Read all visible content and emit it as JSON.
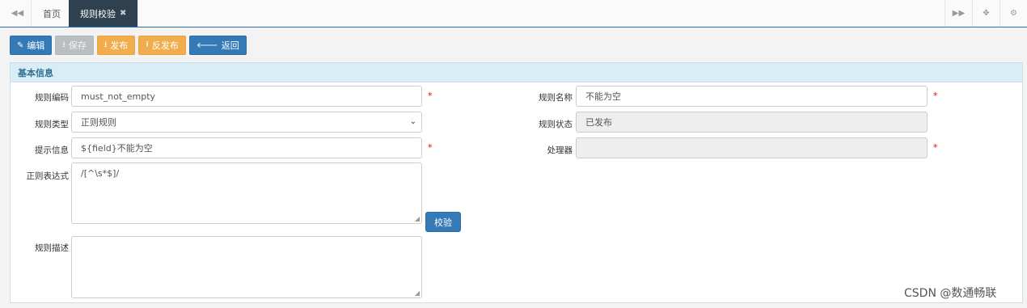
{
  "tabs": {
    "home_label": "首页",
    "active_label": "规则校验",
    "close_glyph": "✖"
  },
  "toolbar": {
    "edit_label": "编辑",
    "save_label": "保存",
    "publish_label": "发布",
    "unpublish_label": "反发布",
    "back_label": "返回"
  },
  "panel": {
    "title": "基本信息"
  },
  "form": {
    "rule_code_label": "规则编码",
    "rule_code_value": "must_not_empty",
    "rule_name_label": "规则名称",
    "rule_name_value": "不能为空",
    "rule_type_label": "规则类型",
    "rule_type_value": "正则规则",
    "rule_status_label": "规则状态",
    "rule_status_value": "已发布",
    "hint_label": "提示信息",
    "hint_value": "${field}不能为空",
    "processor_label": "处理器",
    "processor_value": "",
    "regex_label": "正则表达式",
    "regex_value": "/[^\\s*$]/",
    "check_button_label": "校验",
    "desc_label": "规则描述",
    "desc_value": "",
    "required_mark": "*"
  },
  "watermark": "CSDN @数通畅联"
}
